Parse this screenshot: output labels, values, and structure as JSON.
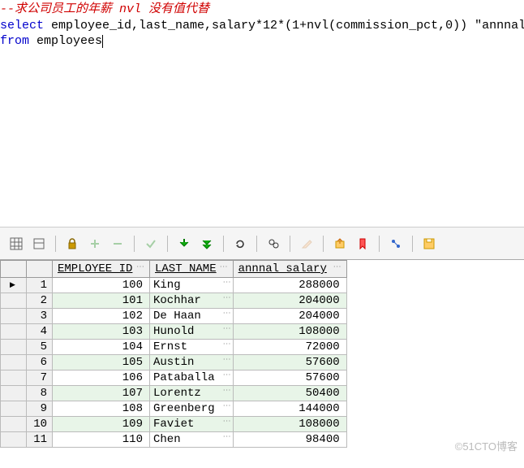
{
  "sql": {
    "comment_prefix": "--",
    "comment_text": "求公司员工的年薪 nvl 没有值代替",
    "line2_select": "select",
    "line2_rest": " employee_id,last_name,salary*12*(1+nvl(commission_pct,0)) \"annnal",
    "line3_from": "from",
    "line3_rest": " employees"
  },
  "toolbar_icons": {
    "grid": "grid-icon",
    "single": "single-icon",
    "lock": "lock-icon",
    "add": "plus-icon",
    "remove": "minus-icon",
    "commit_green": "check-icon",
    "fetch": "fetch-icon",
    "fetch_all": "fetch-all-icon",
    "refresh": "refresh-icon",
    "find": "find-icon",
    "edit": "edit-icon",
    "export": "export-icon",
    "bookmark": "bookmark-icon",
    "link": "link-icon",
    "save": "save-icon"
  },
  "columns": {
    "empty": "",
    "employee_id": "EMPLOYEE_ID",
    "last_name": "LAST_NAME",
    "annual_salary": "annnal salary"
  },
  "rows": [
    {
      "n": 1,
      "employee_id": 100,
      "last_name": "King",
      "annual_salary": 288000
    },
    {
      "n": 2,
      "employee_id": 101,
      "last_name": "Kochhar",
      "annual_salary": 204000
    },
    {
      "n": 3,
      "employee_id": 102,
      "last_name": "De Haan",
      "annual_salary": 204000
    },
    {
      "n": 4,
      "employee_id": 103,
      "last_name": "Hunold",
      "annual_salary": 108000
    },
    {
      "n": 5,
      "employee_id": 104,
      "last_name": "Ernst",
      "annual_salary": 72000
    },
    {
      "n": 6,
      "employee_id": 105,
      "last_name": "Austin",
      "annual_salary": 57600
    },
    {
      "n": 7,
      "employee_id": 106,
      "last_name": "Pataballa",
      "annual_salary": 57600
    },
    {
      "n": 8,
      "employee_id": 107,
      "last_name": "Lorentz",
      "annual_salary": 50400
    },
    {
      "n": 9,
      "employee_id": 108,
      "last_name": "Greenberg",
      "annual_salary": 144000
    },
    {
      "n": 10,
      "employee_id": 109,
      "last_name": "Faviet",
      "annual_salary": 108000
    },
    {
      "n": 11,
      "employee_id": 110,
      "last_name": "Chen",
      "annual_salary": 98400
    }
  ],
  "watermark": "©51CTO博客"
}
